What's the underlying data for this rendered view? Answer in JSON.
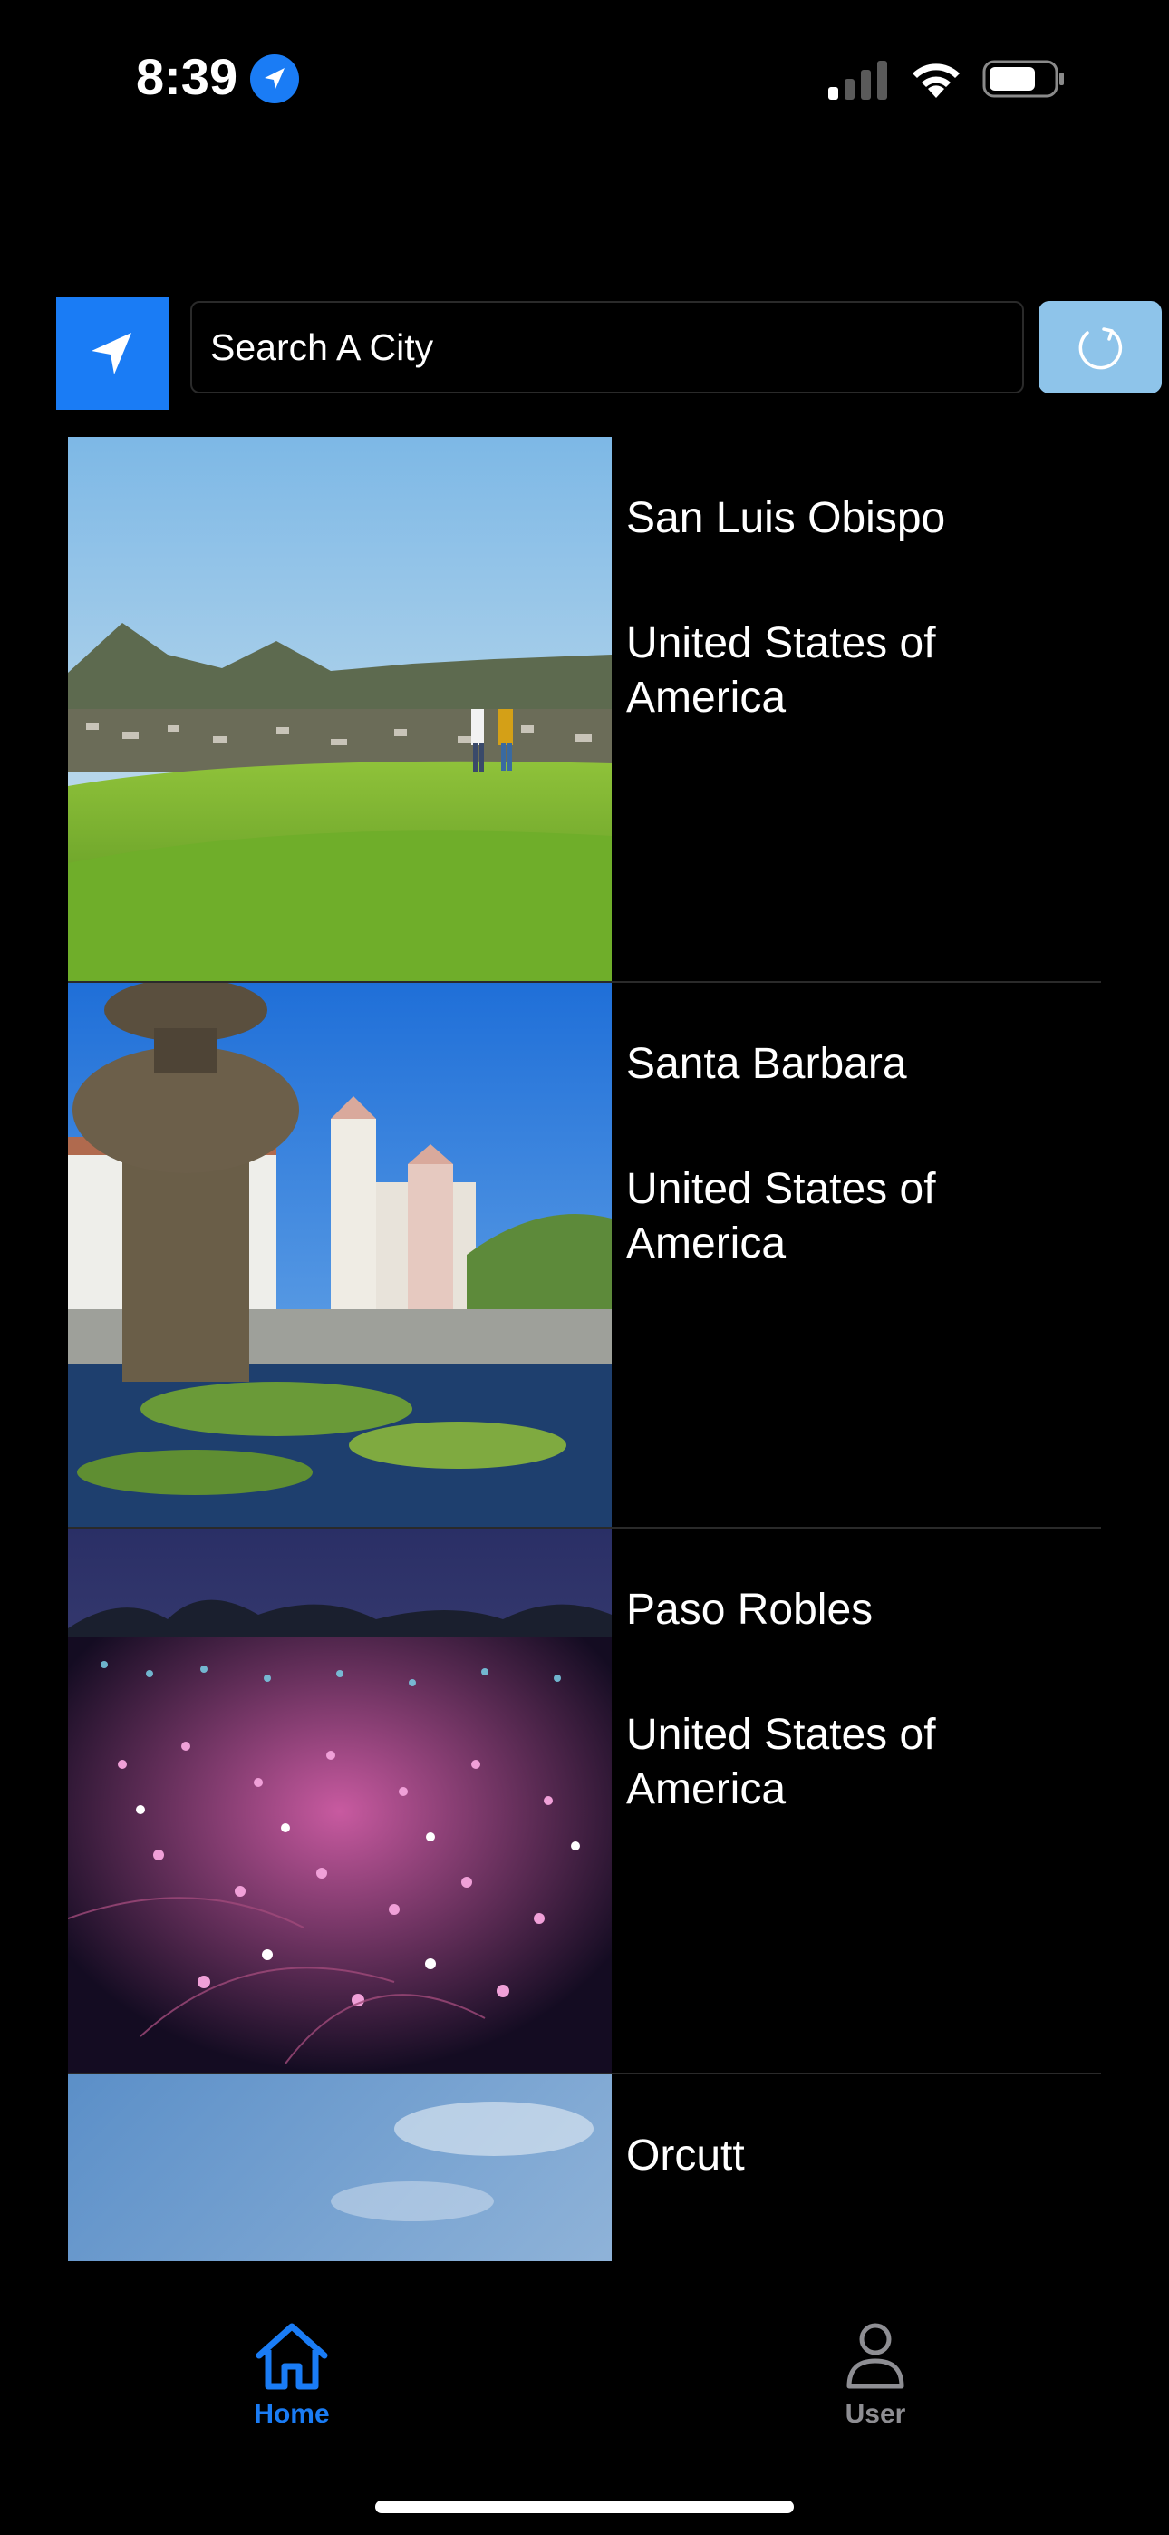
{
  "status_bar": {
    "time": "8:39",
    "location_icon": "location-arrow-icon",
    "signal_icon": "cellular-signal-icon",
    "wifi_icon": "wifi-icon",
    "battery_icon": "battery-icon"
  },
  "search": {
    "placeholder": "Search A City",
    "value": "",
    "locate_icon": "location-arrow-icon",
    "refresh_icon": "refresh-icon"
  },
  "cities": [
    {
      "name": "San Luis Obispo",
      "country": "United States of America"
    },
    {
      "name": "Santa Barbara",
      "country": "United States of America"
    },
    {
      "name": "Paso Robles",
      "country": "United States of America"
    },
    {
      "name": "Orcutt",
      "country": ""
    }
  ],
  "tabs": [
    {
      "label": "Home",
      "icon": "home-icon",
      "active": true
    },
    {
      "label": "User",
      "icon": "user-icon",
      "active": false
    }
  ],
  "colors": {
    "accent": "#1a7cf5",
    "refresh_button": "#8ec4ea",
    "inactive_tab": "#8e8e93",
    "background": "#000000"
  }
}
